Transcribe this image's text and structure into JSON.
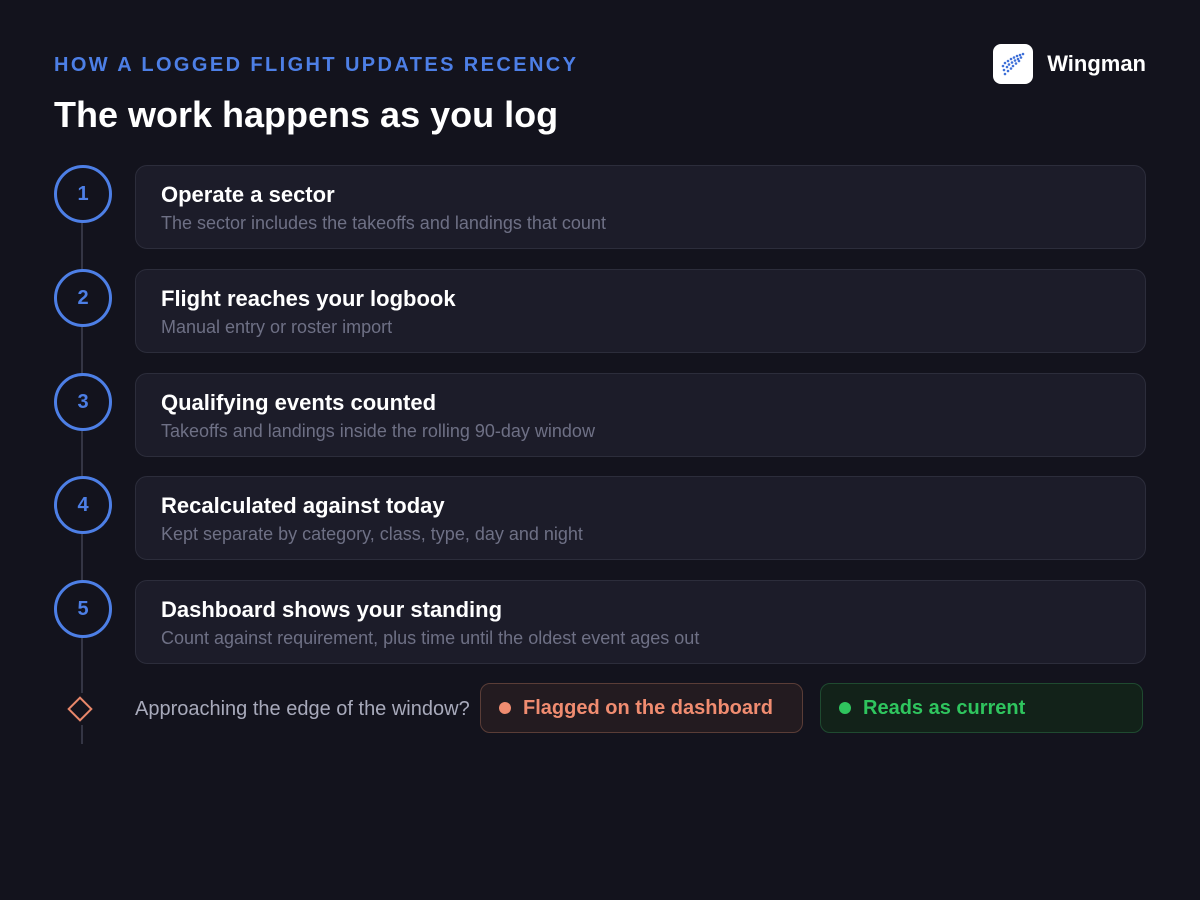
{
  "header": {
    "eyebrow": "HOW A LOGGED FLIGHT UPDATES RECENCY",
    "title": "The work happens as you log"
  },
  "brand": {
    "name": "Wingman",
    "logo_icon": "paper-plane-icon"
  },
  "steps": [
    {
      "number": "1",
      "title": "Operate a sector",
      "description": "The sector includes the takeoffs and landings that count"
    },
    {
      "number": "2",
      "title": "Flight reaches your logbook",
      "description": "Manual entry or roster import"
    },
    {
      "number": "3",
      "title": "Qualifying events counted",
      "description": "Takeoffs and landings inside the rolling 90-day window"
    },
    {
      "number": "4",
      "title": "Recalculated against today",
      "description": "Kept separate by category, class, type, day and night"
    },
    {
      "number": "5",
      "title": "Dashboard shows your standing",
      "description": "Count against requirement, plus time until the oldest event ages out"
    }
  ],
  "decision": {
    "question": "Approaching the edge of the window?",
    "outcomes": [
      {
        "label": "Flagged on the dashboard",
        "color": "#f08c70"
      },
      {
        "label": "Reads as current",
        "color": "#2fc55e"
      }
    ]
  },
  "colors": {
    "accent": "#4d7fe6",
    "background": "#13131d",
    "card": "#1c1c29",
    "warning": "#f08c70",
    "success": "#2fc55e"
  }
}
